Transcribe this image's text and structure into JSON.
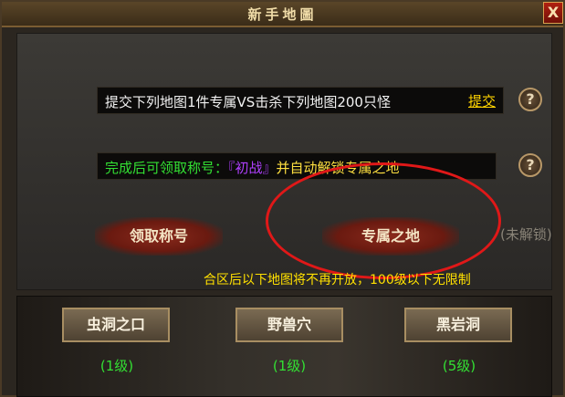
{
  "window": {
    "title": "新手地圖",
    "close_label": "X"
  },
  "task": {
    "text": "提交下列地图1件专属VS击杀下列地图200只怪",
    "submit_label": "提交",
    "help_label": "?"
  },
  "reward": {
    "prefix": "完成后可领取称号：",
    "title_name": "『初战』",
    "suffix": "并自动解锁专属之地",
    "help_label": "?"
  },
  "actions": {
    "claim_title_label": "领取称号",
    "exclusive_area_label": "专属之地",
    "locked_label": "(未解锁)"
  },
  "notice": "合区后以下地图将不再开放，100级以下无限制",
  "maps": [
    {
      "label": "虫洞之口",
      "level": "(1级)"
    },
    {
      "label": "野兽穴",
      "level": "(1级)"
    },
    {
      "label": "黑岩洞",
      "level": "(5级)"
    }
  ],
  "colors": {
    "accent_green": "#33e033",
    "accent_yellow": "#ffe000",
    "title_purple": "#b040ff",
    "annotation_red": "#e01818"
  }
}
